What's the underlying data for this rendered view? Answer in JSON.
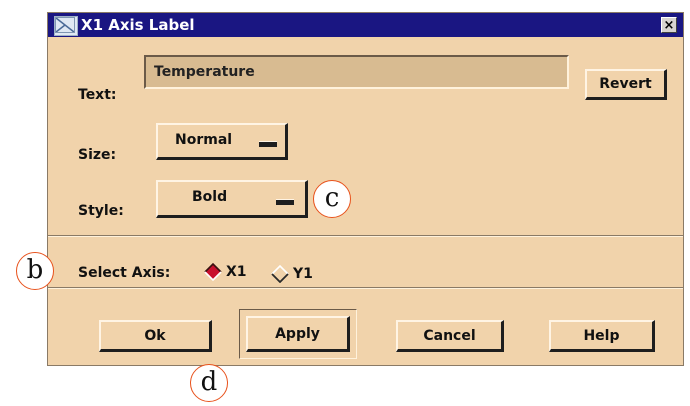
{
  "window": {
    "title": "X1 Axis Label",
    "close_label": "×"
  },
  "text_row": {
    "label": "Text:",
    "value": "Temperature",
    "revert_label": "Revert"
  },
  "size_row": {
    "label": "Size:",
    "selected": "Normal"
  },
  "style_row": {
    "label": "Style:",
    "selected": "Bold"
  },
  "axis_row": {
    "label": "Select Axis:",
    "options": [
      {
        "label": "X1",
        "selected": true
      },
      {
        "label": "Y1",
        "selected": false
      }
    ]
  },
  "buttons": {
    "ok": "Ok",
    "apply": "Apply",
    "cancel": "Cancel",
    "help": "Help"
  },
  "callouts": {
    "b": "b",
    "c": "c",
    "d": "d"
  },
  "colors": {
    "dialog_bg": "#f1d3ab",
    "titlebar_bg": "#1a1682",
    "radio_selected": "#c8102e",
    "callout_border": "#e8521c"
  },
  "icons": {
    "window_icon": "motif-window-icon",
    "close": "close-icon",
    "option_indicator": "option-menu-indicator-icon",
    "radio": "diamond-radio-icon"
  }
}
